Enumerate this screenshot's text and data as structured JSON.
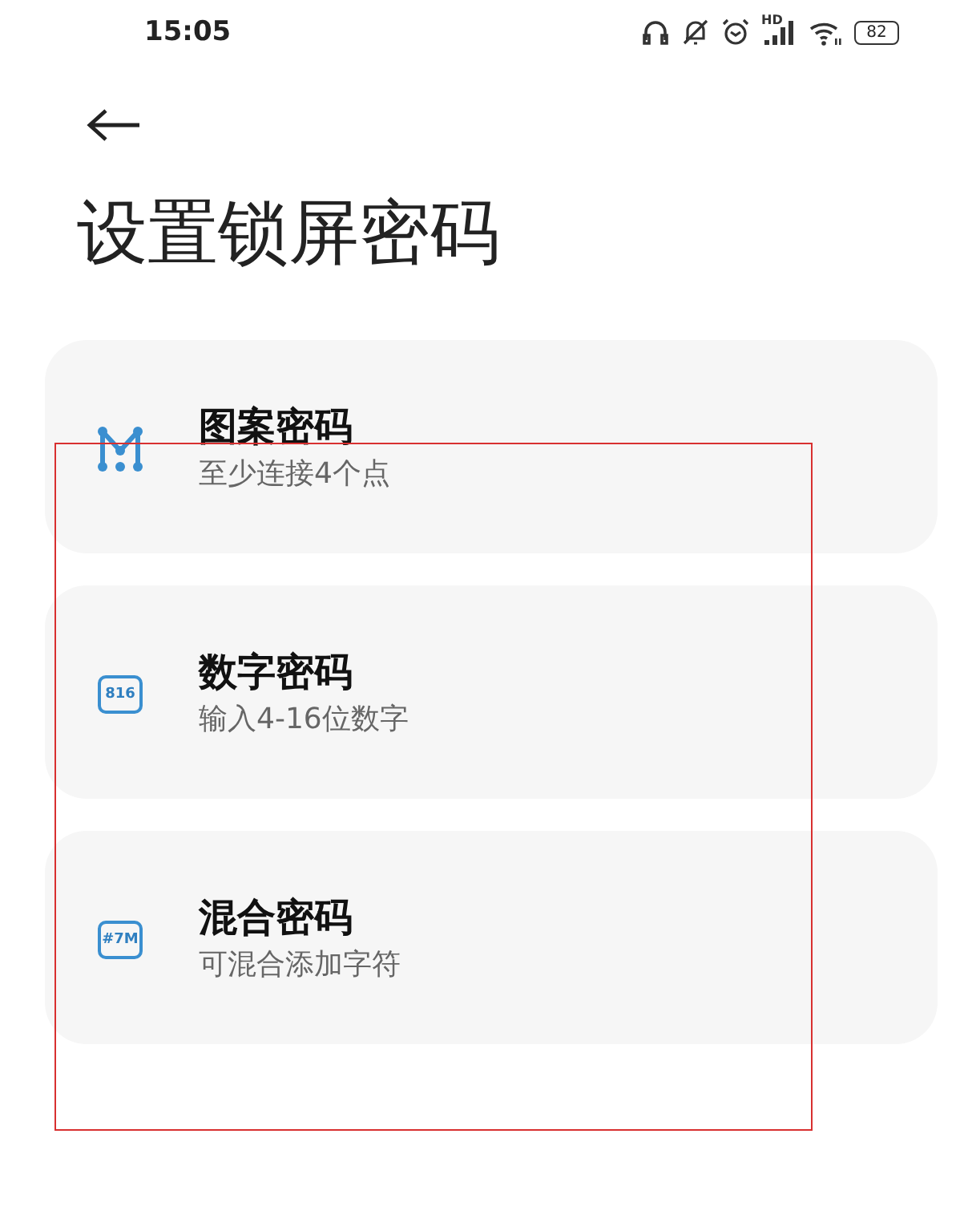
{
  "status_bar": {
    "time": "15:05",
    "signal_label": "HD",
    "battery": "82"
  },
  "page": {
    "title": "设置锁屏密码"
  },
  "options": [
    {
      "kind": "pattern",
      "title": "图案密码",
      "subtitle": "至少连接4个点"
    },
    {
      "kind": "pin",
      "icon_text": "816",
      "title": "数字密码",
      "subtitle": "输入4-16位数字"
    },
    {
      "kind": "mixed",
      "icon_text": "#7M",
      "title": "混合密码",
      "subtitle": "可混合添加字符"
    }
  ]
}
